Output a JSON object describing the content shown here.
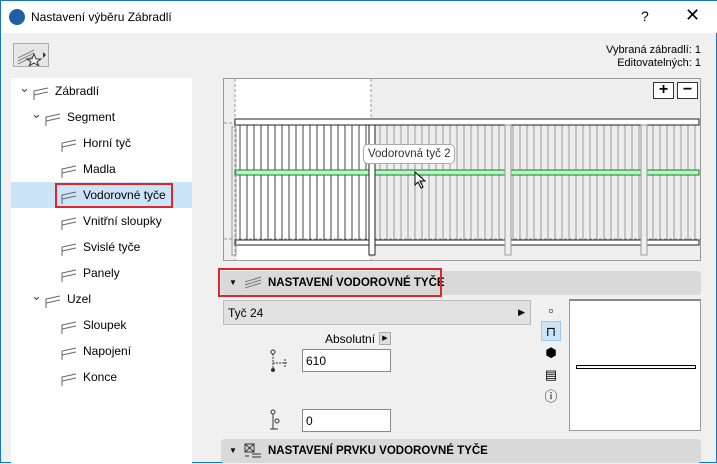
{
  "window": {
    "title": "Nastavení výběru Zábradlí",
    "help": "?",
    "close": "✕"
  },
  "info": {
    "selected": "Vybraná zábradlí: 1",
    "editable": "Editovatelných: 1"
  },
  "tree": [
    {
      "label": "Zábradlí",
      "level": 0,
      "expanded": true
    },
    {
      "label": "Segment",
      "level": 1,
      "expanded": true
    },
    {
      "label": "Horní tyč",
      "level": 2
    },
    {
      "label": "Madla",
      "level": 2
    },
    {
      "label": "Vodorovné tyče",
      "level": 2,
      "selected": true
    },
    {
      "label": "Vnitřní sloupky",
      "level": 2
    },
    {
      "label": "Svislé tyče",
      "level": 2
    },
    {
      "label": "Panely",
      "level": 2
    },
    {
      "label": "Uzel",
      "level": 1,
      "expanded": true
    },
    {
      "label": "Sloupek",
      "level": 2
    },
    {
      "label": "Napojení",
      "level": 2
    },
    {
      "label": "Konce",
      "level": 2
    }
  ],
  "preview": {
    "tooltip": "Vodorovná tyč 2",
    "zoom_in": "+",
    "zoom_out": "−",
    "highlight_color": "#b8f5c4"
  },
  "section1": {
    "title": "NASTAVENÍ VODOROVNÉ TYČE",
    "profile": "Tyč 24",
    "mode": "Absolutní",
    "height_value": "610",
    "offset_value": "0"
  },
  "section2": {
    "title": "NASTAVENÍ PRVKU VODOROVNÉ TYČE"
  },
  "accent": "#e0262b"
}
